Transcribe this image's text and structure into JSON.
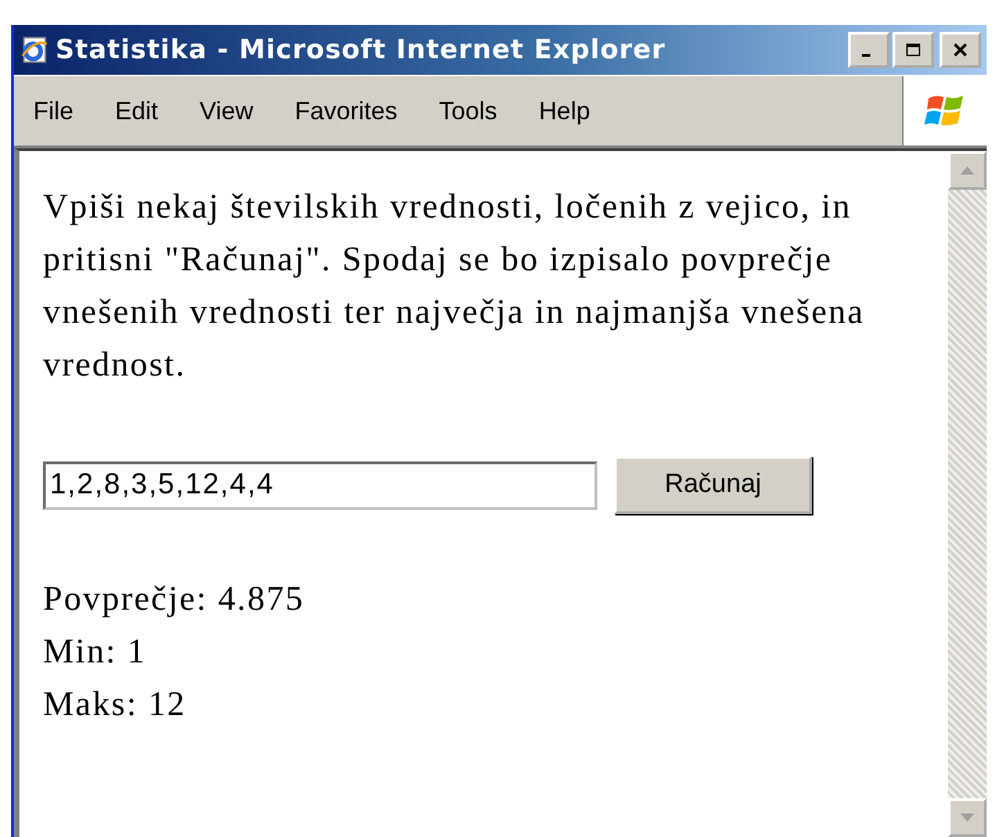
{
  "window": {
    "title": "Statistika - Microsoft Internet Explorer"
  },
  "menu": [
    {
      "label": "File"
    },
    {
      "label": "Edit"
    },
    {
      "label": "View"
    },
    {
      "label": "Favorites"
    },
    {
      "label": "Tools"
    },
    {
      "label": "Help"
    }
  ],
  "page": {
    "intro": "Vpiši nekaj številskih vrednosti, ločenih z vejico, in pritisni \"Računaj\". Spodaj se bo izpisalo povprečje vnešenih vrednosti ter največja in najmanjša vnešena vrednost.",
    "input": {
      "value": "1,2,8,3,5,12,4,4"
    },
    "button": "Računaj",
    "results": [
      "Povprečje: 4.875",
      "Min: 1",
      "Maks: 12"
    ]
  }
}
